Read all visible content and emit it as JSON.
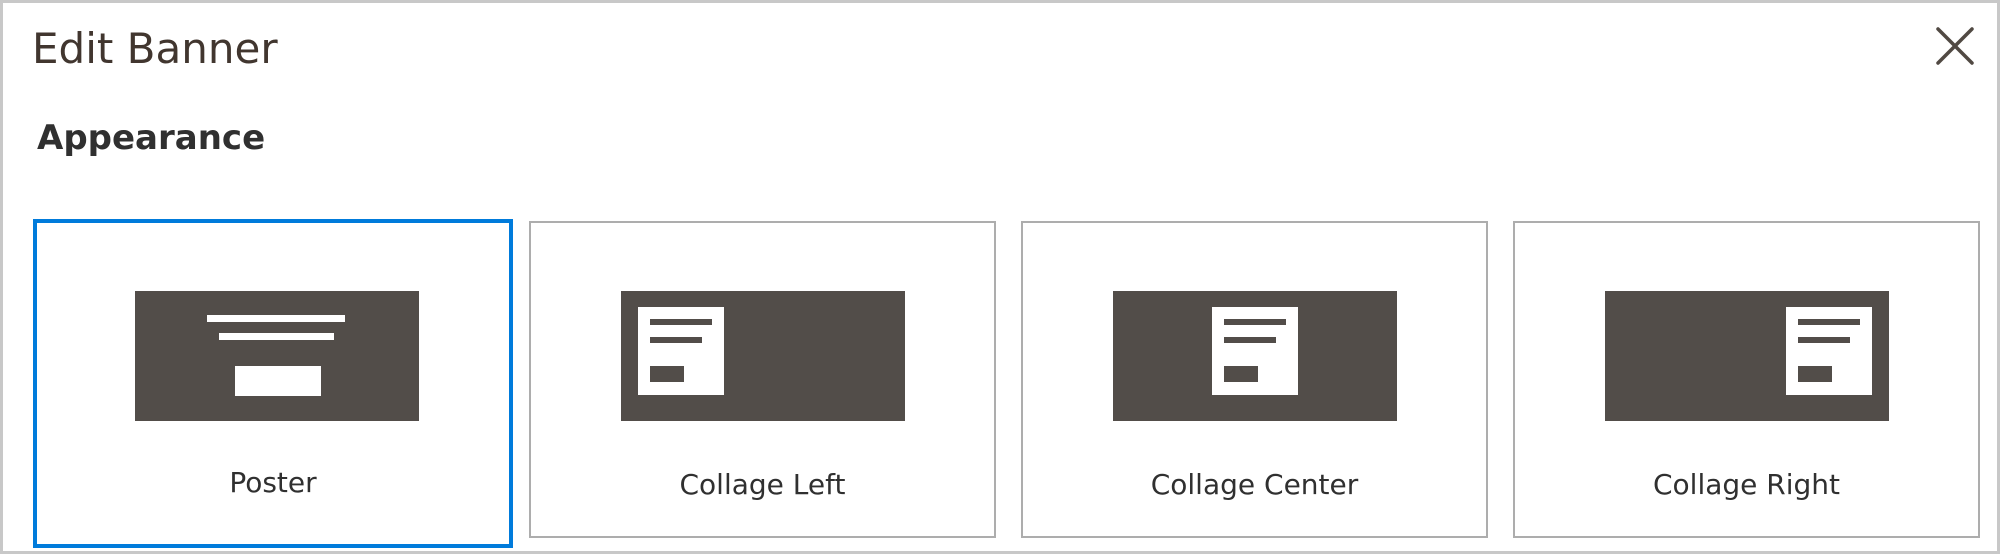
{
  "modal": {
    "title": "Edit Banner",
    "close_icon": "close-icon"
  },
  "appearance": {
    "label": "Appearance",
    "selected": "Poster",
    "options": [
      {
        "label": "Poster",
        "icon": "poster-layout-icon",
        "selected": true
      },
      {
        "label": "Collage Left",
        "icon": "collage-left-layout-icon",
        "selected": false
      },
      {
        "label": "Collage Center",
        "icon": "collage-center-layout-icon",
        "selected": false
      },
      {
        "label": "Collage Right",
        "icon": "collage-right-layout-icon",
        "selected": false
      }
    ]
  },
  "colors": {
    "accent": "#007bdb",
    "thumbnail": "#524d49",
    "border": "#adadad",
    "text": "#303030"
  }
}
